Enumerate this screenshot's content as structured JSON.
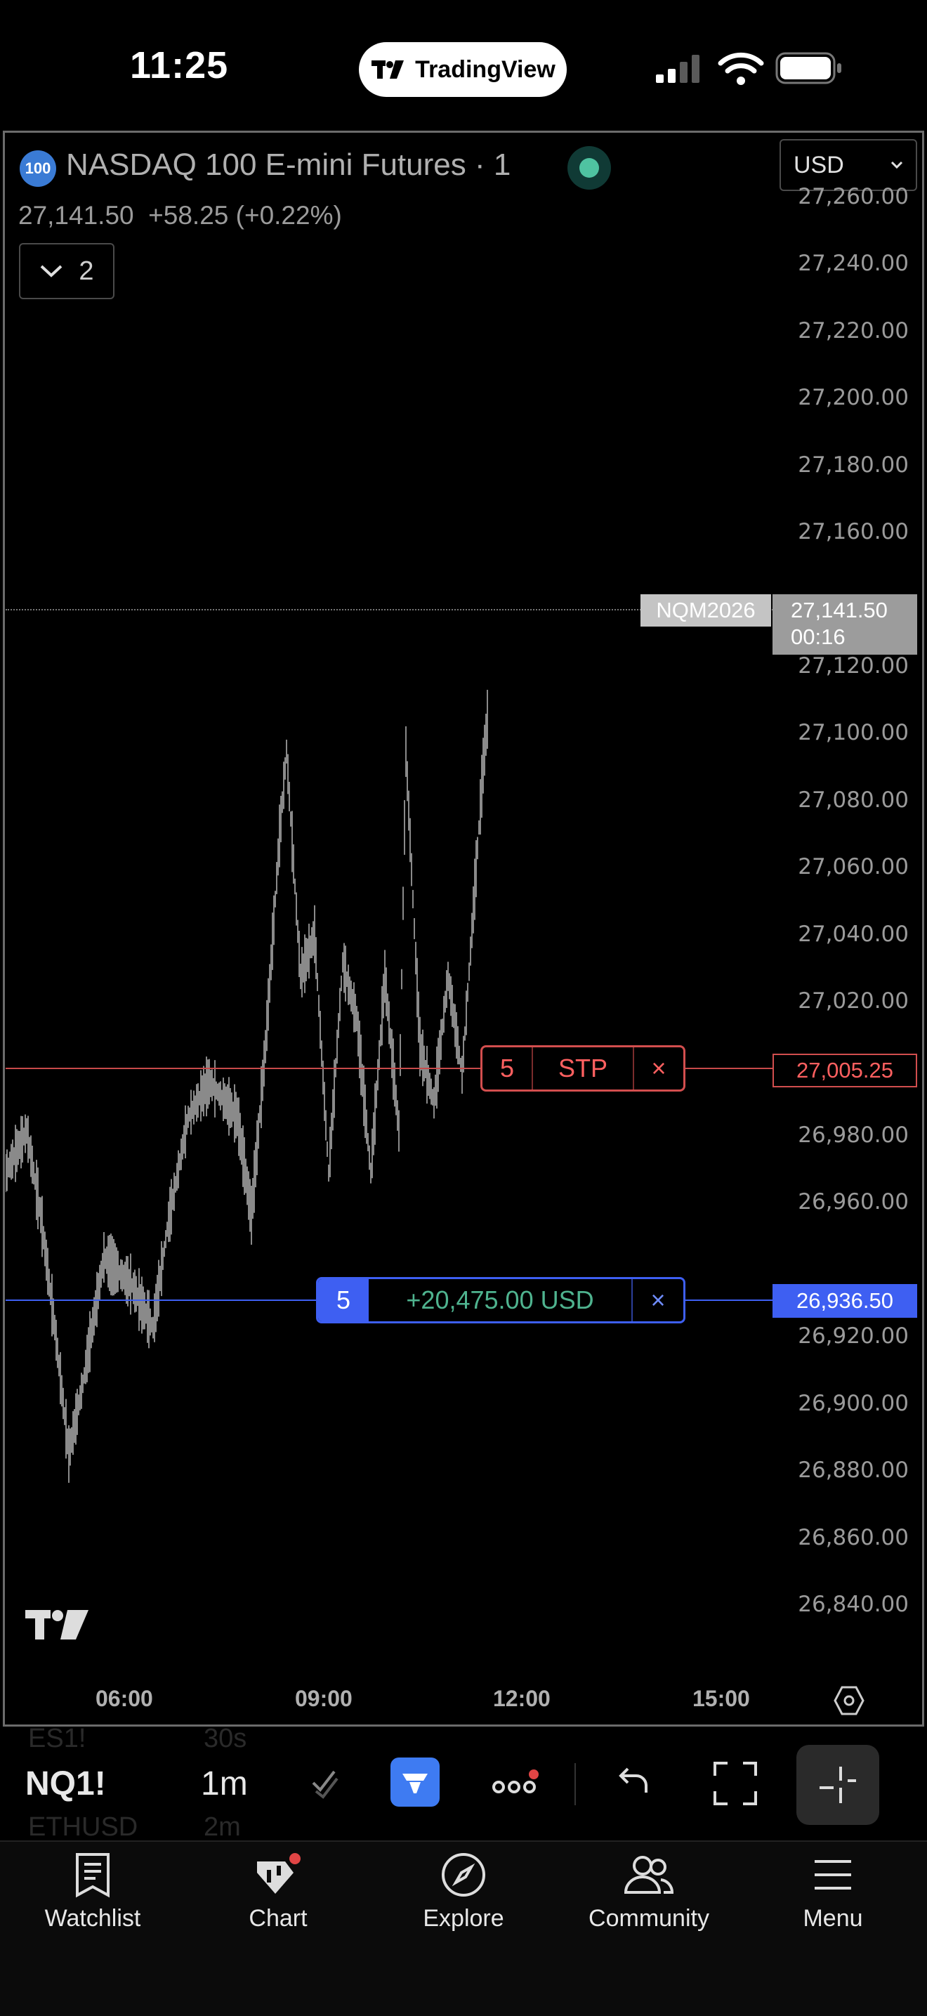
{
  "status_bar": {
    "time": "11:25",
    "center_app": "TradingView"
  },
  "header": {
    "badge": "100",
    "title": "NASDAQ 100 E-mini Futures · 1",
    "last": "27,141.50",
    "change": "+58.25 (+0.22%)",
    "indicators_count": "2",
    "currency": "USD"
  },
  "price_axis": {
    "ticks": [
      "27,260.00",
      "27,240.00",
      "27,220.00",
      "27,200.00",
      "27,180.00",
      "27,160.00",
      "27,120.00",
      "27,100.00",
      "27,080.00",
      "27,060.00",
      "27,040.00",
      "27,020.00",
      "26,980.00",
      "26,960.00",
      "26,920.00",
      "26,900.00",
      "26,880.00",
      "26,860.00",
      "26,840.00"
    ],
    "min": 26840,
    "max": 27260
  },
  "last_price": {
    "contract": "NQM2026",
    "price": "27,141.50",
    "countdown": "00:16",
    "value": 27141.5
  },
  "stop_order": {
    "qty": "5",
    "type": "STP",
    "close": "×",
    "price": "27,005.25",
    "value": 27005.25
  },
  "position": {
    "qty": "5",
    "pnl": "+20,475.00 USD",
    "close": "×",
    "price": "26,936.50",
    "value": 26936.5
  },
  "time_axis": {
    "ticks": [
      "06:00",
      "09:00",
      "12:00",
      "15:00"
    ]
  },
  "toolbar": {
    "ghost_rows": [
      "ES1!",
      "30s",
      "ETHUSD",
      "2m"
    ],
    "symbol": "NQ1!",
    "interval": "1m"
  },
  "bottom_nav": {
    "items": [
      {
        "label": "Watchlist",
        "icon": "watchlist-icon"
      },
      {
        "label": "Chart",
        "icon": "chart-icon"
      },
      {
        "label": "Explore",
        "icon": "compass-icon"
      },
      {
        "label": "Community",
        "icon": "community-icon"
      },
      {
        "label": "Menu",
        "icon": "menu-icon"
      }
    ]
  },
  "colors": {
    "stop": "#d24e4e",
    "position": "#3e5ff2",
    "profit": "#4fb38f",
    "live": "#4fc3a1",
    "candles": "#8a8a8a"
  }
}
